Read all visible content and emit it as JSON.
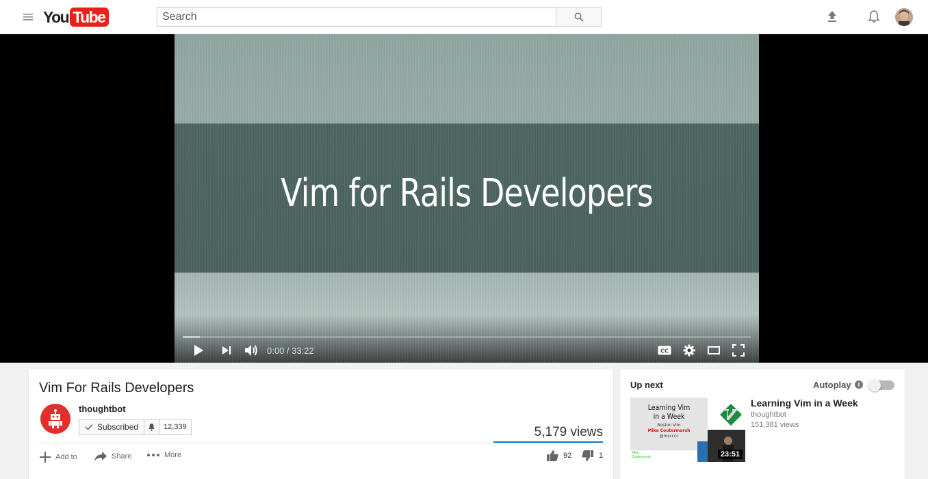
{
  "masthead": {
    "logo_you": "You",
    "logo_tube": "Tube",
    "search_placeholder": "Search",
    "icons": [
      "menu-icon",
      "search-icon",
      "upload-icon",
      "bell-icon",
      "avatar"
    ]
  },
  "player": {
    "video_title_overlay": "Vim for Rails Developers",
    "time_display": "0:00 / 33:22",
    "progress_loaded": 0.03,
    "colors": {
      "band_light": "#97aca7",
      "band_dark": "#4a625e"
    }
  },
  "video": {
    "title": "Vim For Rails Developers",
    "channel": "thoughtbot",
    "subscribe_label": "Subscribed",
    "subscriber_count": "12,339",
    "views": "5,179 views",
    "actions": {
      "add_to": "Add to",
      "share": "Share",
      "more": "More"
    },
    "likes": "92",
    "dislikes": "1",
    "colors": {
      "brand_red": "#e62117",
      "views_bar": "#167ac6"
    }
  },
  "sidebar": {
    "up_next": "Up next",
    "autoplay": "Autoplay",
    "info": "i",
    "related": {
      "title": "Learning Vim in a Week",
      "channel": "thoughtbot",
      "views": "151,381 views",
      "duration": "23:51",
      "thumb_line1": "Learning Vim",
      "thumb_line2": "in a Week",
      "thumb_sub1": "Boston Vim",
      "thumb_sub2": "Mike Coutermarsh",
      "thumb_sub3": "@mscccc",
      "thumb_strip1": "Mike",
      "thumb_strip2": "Coutermarsh"
    }
  }
}
